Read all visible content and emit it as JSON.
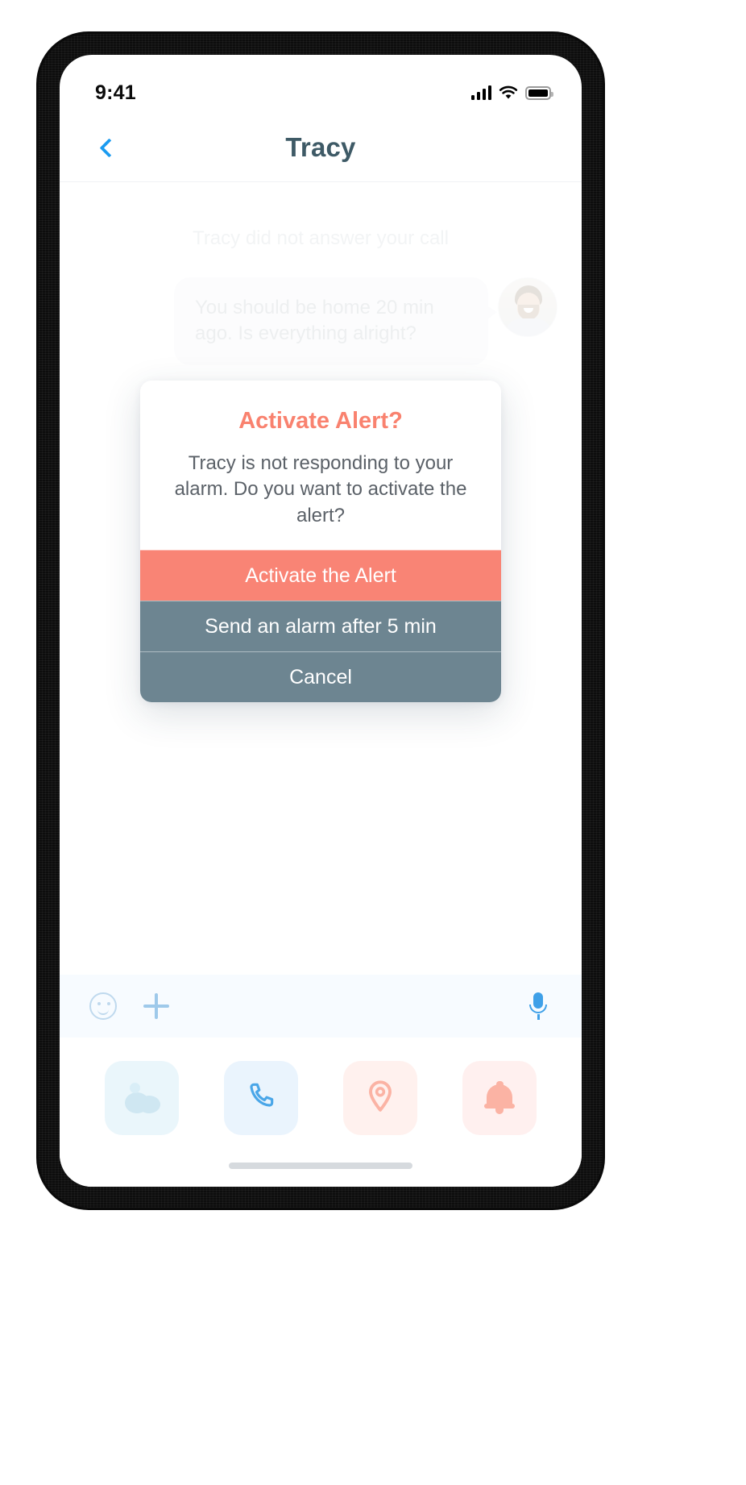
{
  "status_bar": {
    "time": "9:41",
    "icons": [
      "cellular-signal-icon",
      "wifi-icon",
      "battery-icon"
    ]
  },
  "nav_bar": {
    "back_icon": "chevron-left-icon",
    "title": "Tracy"
  },
  "chat": {
    "system_note": "Tracy did not answer your call",
    "messages": [
      {
        "text": "You should be home 20 min ago. Is everything alright?",
        "side": "outgoing",
        "avatar": "user-avatar"
      }
    ]
  },
  "modal": {
    "title": "Activate Alert?",
    "body": "Tracy is not responding to your alarm. Do you want to activate the alert?",
    "buttons": [
      {
        "label": "Activate the Alert",
        "style": "primary"
      },
      {
        "label": "Send an alarm after 5 min",
        "style": "secondary"
      },
      {
        "label": "Cancel",
        "style": "secondary"
      }
    ]
  },
  "input_bar": {
    "placeholder": "",
    "value": "",
    "left_icons": [
      "emoji-icon",
      "plus-icon"
    ],
    "right_icons": [
      "microphone-icon"
    ]
  },
  "action_tiles": [
    {
      "name": "photo-tile",
      "icon": "photo-icon"
    },
    {
      "name": "call-tile",
      "icon": "phone-icon"
    },
    {
      "name": "location-tile",
      "icon": "location-pin-icon"
    },
    {
      "name": "alarm-tile",
      "icon": "bell-icon"
    }
  ],
  "colors": {
    "accent_coral": "#F98475",
    "secondary_slate": "#6D8591",
    "title_slate": "#3E5A66",
    "link_blue": "#1B9BF0"
  }
}
